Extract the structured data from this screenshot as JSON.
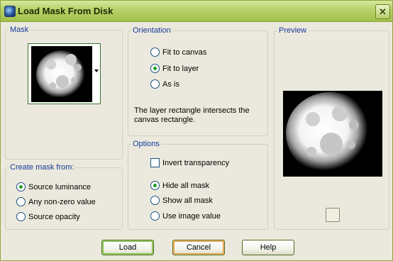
{
  "window": {
    "title": "Load Mask From Disk"
  },
  "mask": {
    "legend": "Mask"
  },
  "create_mask_from": {
    "legend": "Create mask from:",
    "options": [
      "Source luminance",
      "Any non-zero value",
      "Source opacity"
    ],
    "selected": "Source luminance"
  },
  "orientation": {
    "legend": "Orientation",
    "options": [
      "Fit to canvas",
      "Fit to layer",
      "As is"
    ],
    "selected": "Fit to layer",
    "description": "The layer rectangle intersects the canvas rectangle."
  },
  "options": {
    "legend": "Options",
    "invert_transparency": "Invert transparency",
    "invert_checked": false,
    "radios": [
      "Hide all mask",
      "Show all mask",
      "Use image value"
    ],
    "selected": "Hide all mask"
  },
  "preview": {
    "legend": "Preview"
  },
  "buttons": {
    "load": "Load",
    "cancel": "Cancel",
    "help": "Help"
  },
  "icons": {
    "app": "app-icon",
    "close": "close-icon"
  },
  "colors": {
    "legend_text": "#17389b",
    "titlebar": "#b9d36b",
    "radio_dot": "#21a121"
  }
}
